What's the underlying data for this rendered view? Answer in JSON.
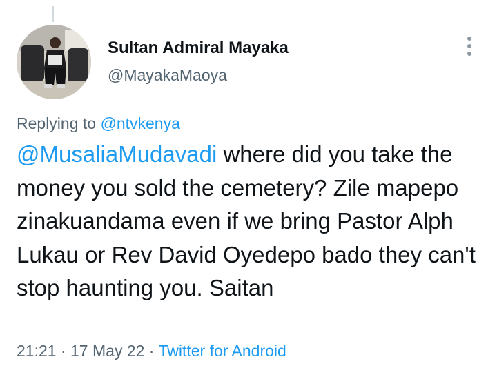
{
  "author": {
    "name": "Sultan Admiral Mayaka",
    "handle": "@MayakaMaoya"
  },
  "reply": {
    "prefix": "Replying to",
    "to": "@ntvkenya"
  },
  "tweet": {
    "mention": "@MusaliaMudavadi",
    "text": " where did you take the money you sold the cemetery? Zile mapepo zinakuandama even if we bring Pastor Alph Lukau or Rev David Oyedepo bado they can't stop haunting you. Saitan"
  },
  "meta": {
    "time": "21:21",
    "separator": " · ",
    "date": "17 May 22",
    "source": "Twitter for Android"
  },
  "icons": {
    "more": "more-vertical-icon"
  },
  "colors": {
    "link": "#1d9bf0",
    "secondary_text": "#536471",
    "primary_text": "#0f1419"
  }
}
